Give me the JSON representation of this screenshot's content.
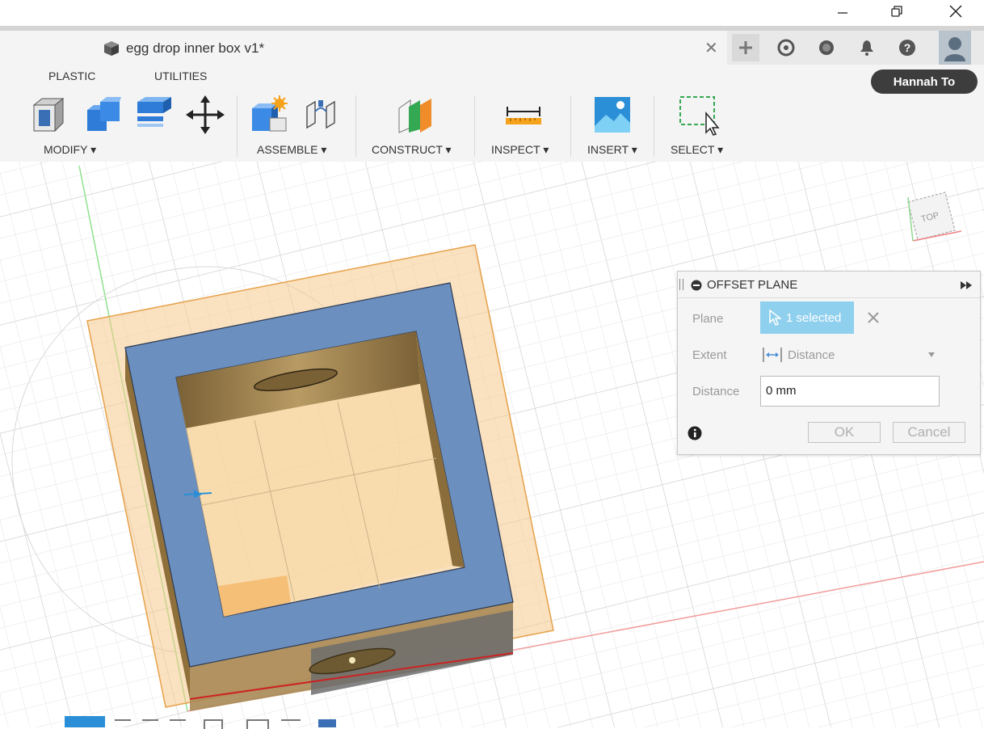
{
  "window": {
    "minimize_icon": "minimize-icon",
    "restore_icon": "restore-icon",
    "close_icon": "close-icon"
  },
  "tab": {
    "title": "egg drop inner box v1*",
    "close": "✕"
  },
  "header_icons": [
    "add-icon",
    "extensions-icon",
    "job-status-icon",
    "notifications-icon",
    "help-icon",
    "avatar"
  ],
  "toolbar": {
    "tabs": [
      "PLASTIC",
      "UTILITIES"
    ],
    "user_name": "Hannah To",
    "groups": {
      "modify": "MODIFY ▾",
      "assemble": "ASSEMBLE ▾",
      "construct": "CONSTRUCT ▾",
      "inspect": "INSPECT ▾",
      "insert": "INSERT ▾",
      "select": "SELECT ▾"
    }
  },
  "viewcube": {
    "face": "TOP"
  },
  "dialog": {
    "title": "OFFSET PLANE",
    "expand_icon": "fast-forward-icon",
    "plane_label": "Plane",
    "plane_value": "1 selected",
    "extent_label": "Extent",
    "extent_value": "Distance",
    "distance_label": "Distance",
    "distance_value": "0 mm",
    "ok_label": "OK",
    "cancel_label": "Cancel"
  },
  "colors": {
    "face_blue": "#6b8fbf",
    "plane_orange": "#f5c98a",
    "accent": "#0696d7",
    "selection_blue": "#8fd0ee"
  }
}
